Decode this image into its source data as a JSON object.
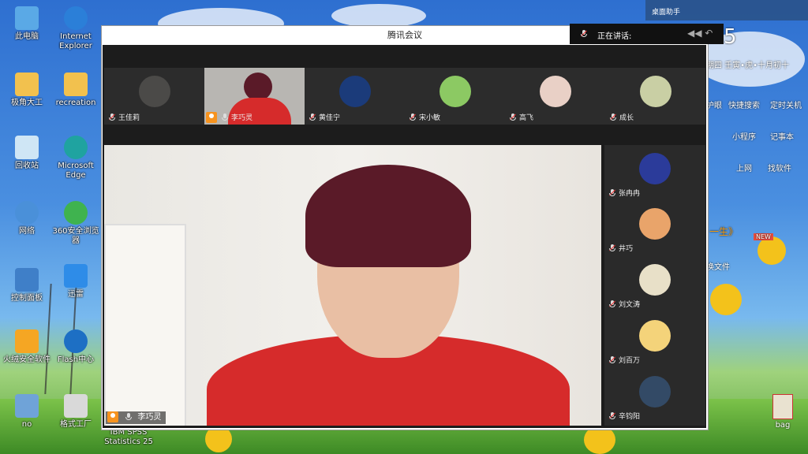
{
  "desktop": {
    "icons_left": [
      {
        "label": "此电脑",
        "icon": "computer-icon"
      },
      {
        "label": "Internet Explorer",
        "icon": "ie-icon"
      },
      {
        "label": "极角大工",
        "icon": "user-folder-icon"
      },
      {
        "label": "recreation",
        "icon": "folder-icon"
      },
      {
        "label": "回收站",
        "icon": "recycle-bin-icon"
      },
      {
        "label": "Microsoft Edge",
        "icon": "edge-icon"
      },
      {
        "label": "网络",
        "icon": "network-icon"
      },
      {
        "label": "360安全浏览器",
        "icon": "360-browser-icon"
      },
      {
        "label": "控制面板",
        "icon": "control-panel-icon"
      },
      {
        "label": "迅雷",
        "icon": "xunlei-icon"
      },
      {
        "label": "火绒安全软件",
        "icon": "huorong-icon"
      },
      {
        "label": "Flash中心",
        "icon": "flash-icon"
      },
      {
        "label": "no",
        "icon": "file-icon"
      },
      {
        "label": "格式工厂",
        "icon": "format-factory-icon"
      }
    ],
    "spss_label": "IBM SPSS Statistics 25",
    "bag_label": "bag",
    "top_assistant": "桌面助手",
    "right_panel": {
      "date_big": "5",
      "lunar": "期四  壬寅•虎•十月初十",
      "items": [
        "护眼",
        "快捷搜索",
        "定时关机",
        "小程序",
        "记事本",
        "上网",
        "找软件"
      ],
      "new_badge": "NEW",
      "text_partial": "一生》",
      "text_partial2": "换文件"
    }
  },
  "meeting": {
    "title": "腾讯会议",
    "speaking_label": "正在讲话:",
    "top_row": [
      {
        "name": "王佳莉",
        "color": "#4b4a48"
      },
      {
        "name": "李巧灵",
        "color": "#b8b6b2",
        "active": true
      },
      {
        "name": "黄佳宁",
        "color": "#1b3b7a"
      },
      {
        "name": "宋小敏",
        "color": "#8cc963"
      },
      {
        "name": "高飞",
        "color": "#e9d0c6"
      },
      {
        "name": "成长",
        "color": "#c9cfa4"
      }
    ],
    "side_col": [
      {
        "name": "张冉冉",
        "color": "#2b3b9a"
      },
      {
        "name": "井巧",
        "color": "#e9a46a"
      },
      {
        "name": "刘文涛",
        "color": "#e8e0c8"
      },
      {
        "name": "刘百万",
        "color": "#f4d37a"
      },
      {
        "name": "辛钧阳",
        "color": "#334a66"
      }
    ],
    "main_speaker": "李巧灵"
  }
}
